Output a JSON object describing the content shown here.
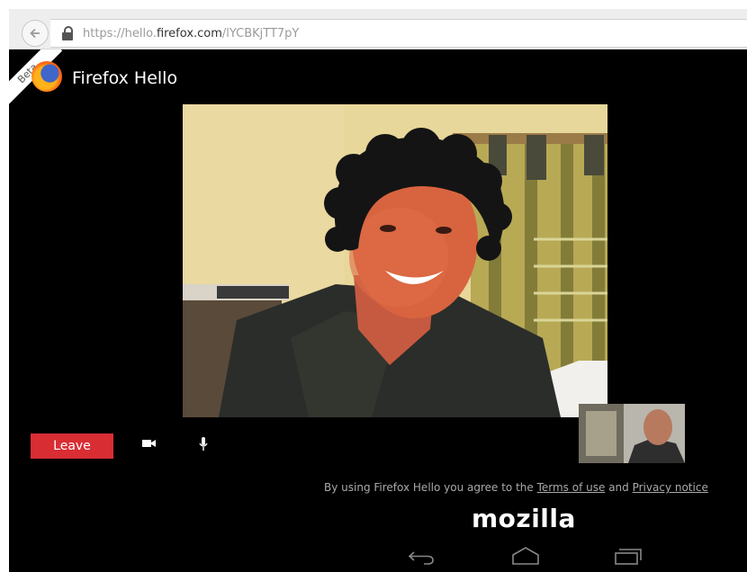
{
  "browser": {
    "url_scheme": "https://",
    "url_sub": "hello.",
    "url_host": "firefox.com",
    "url_path": "/lYCBKjTT7pY",
    "back_icon": "back-arrow-icon",
    "lock_icon": "lock-icon"
  },
  "app": {
    "badge": "Beta",
    "title": "Firefox Hello",
    "logo_icon": "firefox-logo-icon"
  },
  "controls": {
    "leave_label": "Leave",
    "video_icon": "video-camera-icon",
    "mic_icon": "microphone-icon",
    "accent_color": "#d92d34"
  },
  "footer": {
    "terms_prefix": "By using Firefox Hello you agree to the ",
    "terms_link": "Terms of use",
    "terms_and": " and ",
    "privacy_link": "Privacy notice",
    "brand": "mozilla"
  },
  "android_nav": {
    "back_icon": "android-back-icon",
    "home_icon": "android-home-icon",
    "recents_icon": "android-recents-icon"
  }
}
